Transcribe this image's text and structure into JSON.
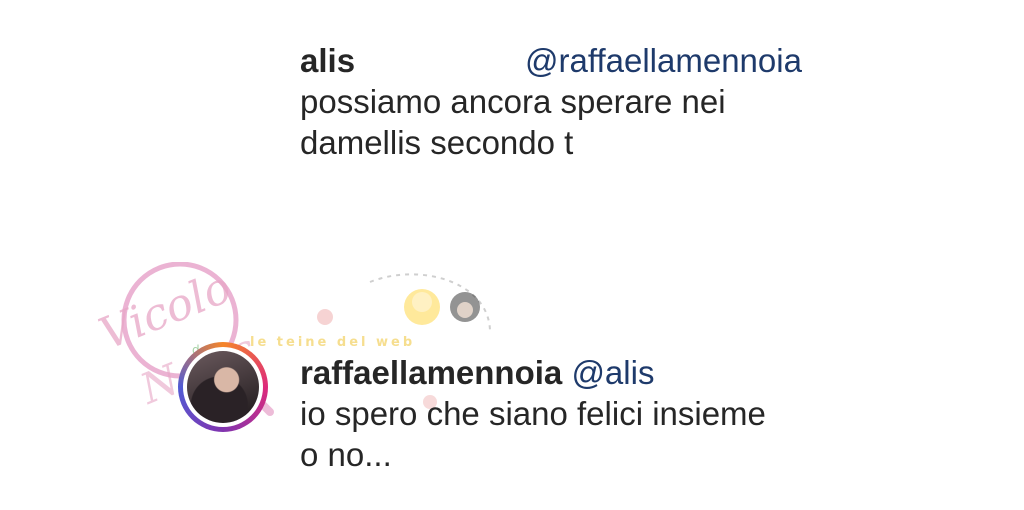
{
  "comments": [
    {
      "username": "alis",
      "mention": "@raffaellamennoia",
      "lines": [
        "possiamo ancora sperare nei",
        "damellis secondo t"
      ]
    },
    {
      "username": "raffaellamennoia",
      "mention": "@alis",
      "lines": [
        "io spero che siano felici insieme",
        "o no..."
      ]
    }
  ],
  "watermark": {
    "script_text": "Vicolo",
    "small_text": "delle",
    "script_text_2": "News",
    "banner_text": "le teine del web"
  }
}
